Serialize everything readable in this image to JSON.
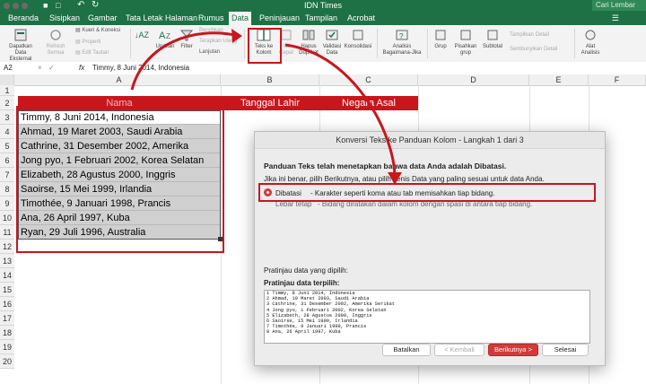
{
  "window": {
    "title": "IDN Times",
    "search_placeholder": "Cari Lembar"
  },
  "tabs": [
    {
      "label": "Beranda"
    },
    {
      "label": "Sisipkan"
    },
    {
      "label": "Gambar"
    },
    {
      "label": "Tata Letak Halaman"
    },
    {
      "label": "Rumus"
    },
    {
      "label": "Data",
      "active": true
    },
    {
      "label": "Peninjauan"
    },
    {
      "label": "Tampilan"
    },
    {
      "label": "Acrobat"
    }
  ],
  "ribbon": {
    "get_data": "Dapatkan Data Eksternal",
    "refresh": "Refresh Semua",
    "queries": "Kueri & Koneksi",
    "properties": "Properti",
    "edit_links": "Edit Tautan",
    "sort": "Urutkan",
    "filter": "Filter",
    "clear": "Bersihkan",
    "reapply": "Terapkan Ulang",
    "advanced": "Lanjutan",
    "text_to_columns": "Teks ke Kolom",
    "flash_fill": "Isi Cepat",
    "remove_duplicates": "Hapus Duplikat",
    "data_validation": "Validasi Data",
    "consolidate": "Konsolidasi",
    "what_if": "Analisis Bagaimana-Jika",
    "group": "Grup",
    "ungroup": "Pisahkan grup",
    "subtotal": "Subtotal",
    "show_detail": "Tampilkan Detail",
    "hide_detail": "Sembunyikan Detail",
    "analysis": "Alat Analisis"
  },
  "formula_bar": {
    "cell_ref": "A2",
    "fx": "fx",
    "value": "Timmy, 8 Juni 2014, Indonesia"
  },
  "columns": [
    "A",
    "B",
    "C",
    "D",
    "E",
    "F"
  ],
  "rows": [
    "1",
    "2",
    "3",
    "4",
    "5",
    "6",
    "7",
    "8",
    "9",
    "10",
    "11",
    "12",
    "13",
    "14",
    "15",
    "16",
    "17",
    "18",
    "19",
    "20"
  ],
  "header_row": {
    "a": "Nama",
    "b": "Tanggal Lahir",
    "c": "Negara Asal"
  },
  "data_rows": [
    "Timmy, 8 Juni 2014, Indonesia",
    "Ahmad, 19 Maret 2003, Saudi Arabia",
    "Cathrine, 31 Desember 2002, Amerika Serikat",
    "Jong pyo, 1 Februari 2002, Korea Selatan",
    "Elizabeth, 28 Agustus 2000, Inggris",
    "Saoirse, 15 Mei 1999, Irlandia",
    "Timothée, 9 Januari 1998, Prancis",
    "Ana, 26 April 1997, Kuba",
    "Ryan, 29 Juli 1996, Australia"
  ],
  "dialog": {
    "title": "Konversi Teks ke Panduan Kolom - Langkah 1 dari 3",
    "heading": "Panduan Teks telah menetapkan bahwa data Anda adalah Dibatasi.",
    "instruction": "Jika ini benar, pilih Berikutnya, atau pilih Jenis Data yang paling sesuai untuk data Anda.",
    "option_delimited": "Dibatasi",
    "option_delimited_desc": "- Karakter seperti koma atau tab memisahkan tiap bidang.",
    "option_fixed": "Lebar tetap",
    "option_fixed_desc": "- Bidang diratakan dalam kolom dengan spasi di antara tiap bidang.",
    "preview_label": "Pratinjau data yang dipilih:",
    "preview_title": "Pratinjau data terpilih:",
    "preview_lines": [
      "1 Timmy, 8 Juni 2014, Indonesia",
      "2 Ahmad, 19 Maret 2003, Saudi Arabia",
      "3 Cathrine, 31 Desember 2002, Amerika Serikat",
      "4 Jong pyo, 1 Februari 2002, Korea Selatan",
      "5 Elizabeth, 28 Agustus 2000, Inggris",
      "6 Saoirse, 15 Mei 1999, Irlandia",
      "7 Timothée, 9 Januari 1998, Prancis",
      "8 Ana, 26 April 1997, Kuba"
    ],
    "btn_cancel": "Batalkan",
    "btn_back": "< Kembali",
    "btn_next": "Berikutnya >",
    "btn_finish": "Selesai"
  },
  "colors": {
    "excel_green": "#1e7145",
    "annotation_red": "#c8161d",
    "header_fill": "#c8161d",
    "selection_gray": "#d0d0d0"
  }
}
